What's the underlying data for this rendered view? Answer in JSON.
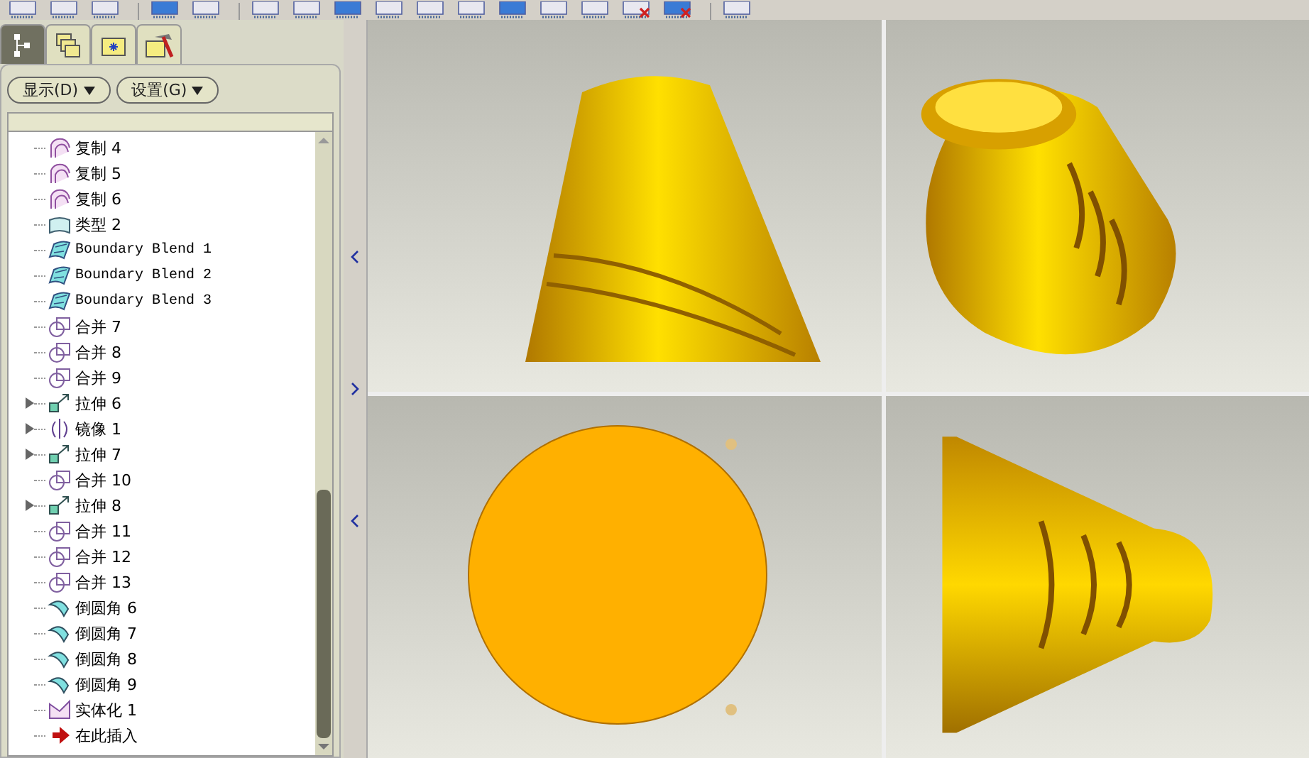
{
  "panel_tabs": [
    {
      "kind": "tree",
      "selected": true
    },
    {
      "kind": "layers",
      "selected": false
    },
    {
      "kind": "folder",
      "selected": false
    },
    {
      "kind": "tools",
      "selected": false
    }
  ],
  "panel_buttons": [
    {
      "label": "显示(D)"
    },
    {
      "label": "设置(G)"
    }
  ],
  "tree": [
    {
      "kind": "copy",
      "label": "复制 4",
      "expandable": false
    },
    {
      "kind": "copy",
      "label": "复制 5",
      "expandable": false
    },
    {
      "kind": "copy",
      "label": "复制 6",
      "expandable": false
    },
    {
      "kind": "type",
      "label": "类型 2",
      "expandable": false
    },
    {
      "kind": "blend",
      "label": "Boundary Blend 1",
      "expandable": false
    },
    {
      "kind": "blend",
      "label": "Boundary Blend 2",
      "expandable": false
    },
    {
      "kind": "blend",
      "label": "Boundary Blend 3",
      "expandable": false
    },
    {
      "kind": "merge",
      "label": "合并 7",
      "expandable": false
    },
    {
      "kind": "merge",
      "label": "合并 8",
      "expandable": false
    },
    {
      "kind": "merge",
      "label": "合并 9",
      "expandable": false
    },
    {
      "kind": "extrude",
      "label": "拉伸 6",
      "expandable": true
    },
    {
      "kind": "mirror",
      "label": "镜像 1",
      "expandable": true
    },
    {
      "kind": "extrude",
      "label": "拉伸 7",
      "expandable": true
    },
    {
      "kind": "merge",
      "label": "合并 10",
      "expandable": false
    },
    {
      "kind": "extrude",
      "label": "拉伸 8",
      "expandable": true
    },
    {
      "kind": "merge",
      "label": "合并 11",
      "expandable": false
    },
    {
      "kind": "merge",
      "label": "合并 12",
      "expandable": false
    },
    {
      "kind": "merge",
      "label": "合并 13",
      "expandable": false
    },
    {
      "kind": "round",
      "label": "倒圆角 6",
      "expandable": false
    },
    {
      "kind": "round",
      "label": "倒圆角 7",
      "expandable": false
    },
    {
      "kind": "round",
      "label": "倒圆角 8",
      "expandable": false
    },
    {
      "kind": "round",
      "label": "倒圆角 9",
      "expandable": false
    },
    {
      "kind": "solidify",
      "label": "实体化 1",
      "expandable": false
    },
    {
      "kind": "insert",
      "label": "在此插入",
      "expandable": false
    }
  ],
  "viewports": [
    {
      "kind": "side"
    },
    {
      "kind": "iso"
    },
    {
      "kind": "top"
    },
    {
      "kind": "front"
    }
  ]
}
